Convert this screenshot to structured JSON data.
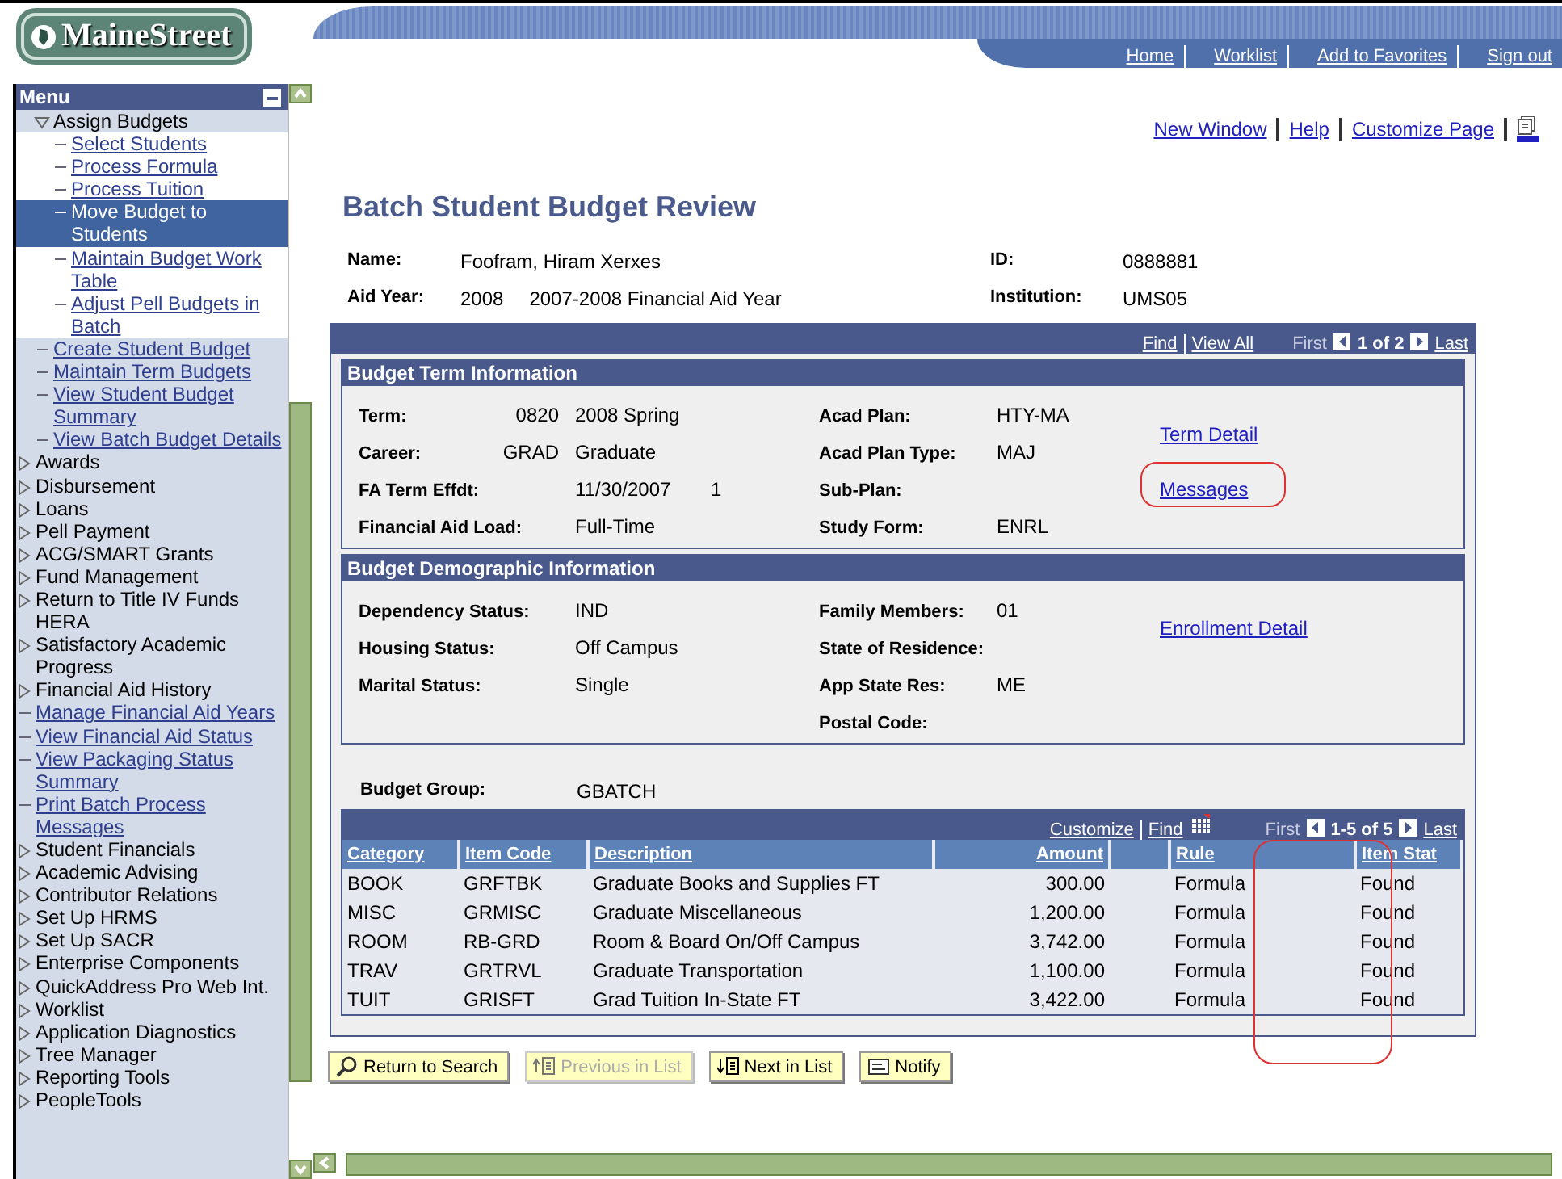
{
  "logo": {
    "text": "MaineStreet"
  },
  "menu": {
    "title": "Menu",
    "items": [
      {
        "kind": "group",
        "children": [
          {
            "kind": "group",
            "children": [
              {
                "label": "Assign Budgets",
                "kind": "folder",
                "expanded": true,
                "selected": false,
                "children": [
                  {
                    "label": "Select Students",
                    "kind": "link",
                    "selected": false
                  },
                  {
                    "label": "Process Formula",
                    "kind": "link",
                    "selected": false
                  },
                  {
                    "label": "Process Tuition",
                    "kind": "link",
                    "selected": false
                  },
                  {
                    "label": "Move Budget to Students",
                    "kind": "link",
                    "selected": true
                  },
                  {
                    "label": "Maintain Budget Work Table",
                    "kind": "link",
                    "selected": false
                  },
                  {
                    "label": "Adjust Pell Budgets in Batch",
                    "kind": "link",
                    "selected": false
                  }
                ]
              },
              {
                "label": "Create Student Budget",
                "kind": "link",
                "selected": false
              },
              {
                "label": "Maintain Term Budgets",
                "kind": "link",
                "selected": false
              },
              {
                "label": "View Student Budget Summary",
                "kind": "link",
                "selected": false
              },
              {
                "label": "View Batch Budget Details",
                "kind": "link",
                "selected": false
              }
            ]
          },
          {
            "label": "Awards",
            "kind": "folder",
            "expanded": false,
            "selected": false
          },
          {
            "label": "Disbursement",
            "kind": "folder",
            "expanded": false,
            "selected": false
          },
          {
            "label": "Loans",
            "kind": "folder",
            "expanded": false,
            "selected": false
          },
          {
            "label": "Pell Payment",
            "kind": "folder",
            "expanded": false,
            "selected": false
          },
          {
            "label": "ACG/SMART Grants",
            "kind": "folder",
            "expanded": false,
            "selected": false
          },
          {
            "label": "Fund Management",
            "kind": "folder",
            "expanded": false,
            "selected": false
          },
          {
            "label": "Return to Title IV Funds HERA",
            "kind": "folder",
            "expanded": false,
            "selected": false
          },
          {
            "label": "Satisfactory Academic Progress",
            "kind": "folder",
            "expanded": false,
            "selected": false
          },
          {
            "label": "Financial Aid History",
            "kind": "folder",
            "expanded": false,
            "selected": false
          },
          {
            "label": "Manage Financial Aid Years",
            "kind": "link",
            "selected": false
          },
          {
            "label": "View Financial Aid Status",
            "kind": "link",
            "selected": false
          },
          {
            "label": "View Packaging Status Summary",
            "kind": "link",
            "selected": false
          },
          {
            "label": "Print Batch Process Messages",
            "kind": "link",
            "selected": false
          }
        ]
      },
      {
        "label": "Student Financials",
        "kind": "folder",
        "expanded": false,
        "selected": false
      },
      {
        "label": "Academic Advising",
        "kind": "folder",
        "expanded": false,
        "selected": false
      },
      {
        "label": "Contributor Relations",
        "kind": "folder",
        "expanded": false,
        "selected": false
      },
      {
        "label": "Set Up HRMS",
        "kind": "folder",
        "expanded": false,
        "selected": false
      },
      {
        "label": "Set Up SACR",
        "kind": "folder",
        "expanded": false,
        "selected": false
      },
      {
        "label": "Enterprise Components",
        "kind": "folder",
        "expanded": false,
        "selected": false
      },
      {
        "label": "QuickAddress Pro Web Int.",
        "kind": "folder",
        "expanded": false,
        "selected": false
      },
      {
        "label": "Worklist",
        "kind": "folder",
        "expanded": false,
        "selected": false
      },
      {
        "label": "Application Diagnostics",
        "kind": "folder",
        "expanded": false,
        "selected": false
      },
      {
        "label": "Tree Manager",
        "kind": "folder",
        "expanded": false,
        "selected": false
      },
      {
        "label": "Reporting Tools",
        "kind": "folder",
        "expanded": false,
        "selected": false
      },
      {
        "label": "PeopleTools",
        "kind": "folder",
        "expanded": false,
        "selected": false
      }
    ]
  },
  "top_nav": [
    "Home",
    "Worklist",
    "Add to Favorites",
    "Sign out"
  ],
  "page_links": [
    "New Window",
    "Help",
    "Customize Page"
  ],
  "title": "Batch Student Budget Review",
  "header_fields": {
    "left": [
      {
        "label": "Name:",
        "value": "Foofram, Hiram Xerxes"
      },
      {
        "label": "Aid Year:",
        "code": "2008",
        "value": "2007-2008 Financial Aid Year"
      }
    ],
    "right": [
      {
        "label": "ID:",
        "value": "0888881"
      },
      {
        "label": "Institution:",
        "value": "UMS05"
      }
    ]
  },
  "panel_nav": {
    "find": "Find",
    "view_all": "View All",
    "first": "First",
    "counter": "1 of 2",
    "last": "Last"
  },
  "term_section": {
    "title": "Budget Term Information",
    "left": [
      {
        "label": "Term:",
        "code": "0820",
        "value": "2008 Spring"
      },
      {
        "label": "Career:",
        "code": "GRAD",
        "value": "Graduate"
      },
      {
        "label": "FA Term Effdt:",
        "value": "11/30/2007",
        "extra": "1"
      },
      {
        "label": "Financial Aid Load:",
        "value": "Full-Time"
      }
    ],
    "right": [
      {
        "label": "Acad Plan:",
        "value": "HTY-MA"
      },
      {
        "label": "Acad Plan Type:",
        "value": "MAJ"
      },
      {
        "label": "Sub-Plan:"
      },
      {
        "label": "Study Form:",
        "value": "ENRL"
      }
    ],
    "links": [
      {
        "label": "Term Detail",
        "circled": false
      },
      {
        "label": "Messages",
        "circled": true
      }
    ]
  },
  "demographic_section": {
    "title": "Budget Demographic Information",
    "left": [
      {
        "label": "Dependency Status:",
        "value": "IND"
      },
      {
        "label": "Housing Status:",
        "value": "Off Campus"
      },
      {
        "label": "Marital Status:",
        "value": "Single"
      }
    ],
    "right": [
      {
        "label": "Family Members:",
        "value": "01"
      },
      {
        "label": "State of Residence:"
      },
      {
        "label": "App State Res:",
        "value": "ME"
      },
      {
        "label": "Postal Code:"
      }
    ],
    "links": [
      {
        "label": "Enrollment Detail",
        "circled": false
      }
    ]
  },
  "budget_group": {
    "label": "Budget Group:",
    "value": "GBATCH"
  },
  "grid": {
    "nav": {
      "customize": "Customize",
      "find": "Find",
      "first": "First",
      "counter": "1-5 of 5",
      "last": "Last"
    },
    "columns": [
      {
        "label": "Category",
        "circled": false
      },
      {
        "label": "Item Code",
        "circled": false
      },
      {
        "label": "Description",
        "circled": false
      },
      {
        "label": "Amount",
        "circled": false
      },
      {
        "circled": false
      },
      {
        "label": "Rule",
        "circled": false
      },
      {
        "label": "Item Stat",
        "circled": true
      }
    ],
    "rows": [
      [
        "BOOK",
        "GRFTBK",
        "Graduate Books and Supplies FT",
        "300.00",
        null,
        "Formula",
        "Found"
      ],
      [
        "MISC",
        "GRMISC",
        "Graduate Miscellaneous",
        "1,200.00",
        null,
        "Formula",
        "Found"
      ],
      [
        "ROOM",
        "RB-GRD",
        "Room & Board On/Off Campus",
        "3,742.00",
        null,
        "Formula",
        "Found"
      ],
      [
        "TRAV",
        "GRTRVL",
        "Graduate Transportation",
        "1,100.00",
        null,
        "Formula",
        "Found"
      ],
      [
        "TUIT",
        "GRISFT",
        "Grad Tuition In-State FT",
        "3,422.00",
        null,
        "Formula",
        "Found"
      ]
    ]
  },
  "buttons": [
    {
      "label": "Return to Search",
      "kind": "search",
      "disabled": false
    },
    {
      "label": "Previous in List",
      "kind": "previous",
      "disabled": true
    },
    {
      "label": "Next in List",
      "kind": "next",
      "disabled": false
    },
    {
      "label": "Notify",
      "kind": "notify",
      "disabled": false
    }
  ]
}
